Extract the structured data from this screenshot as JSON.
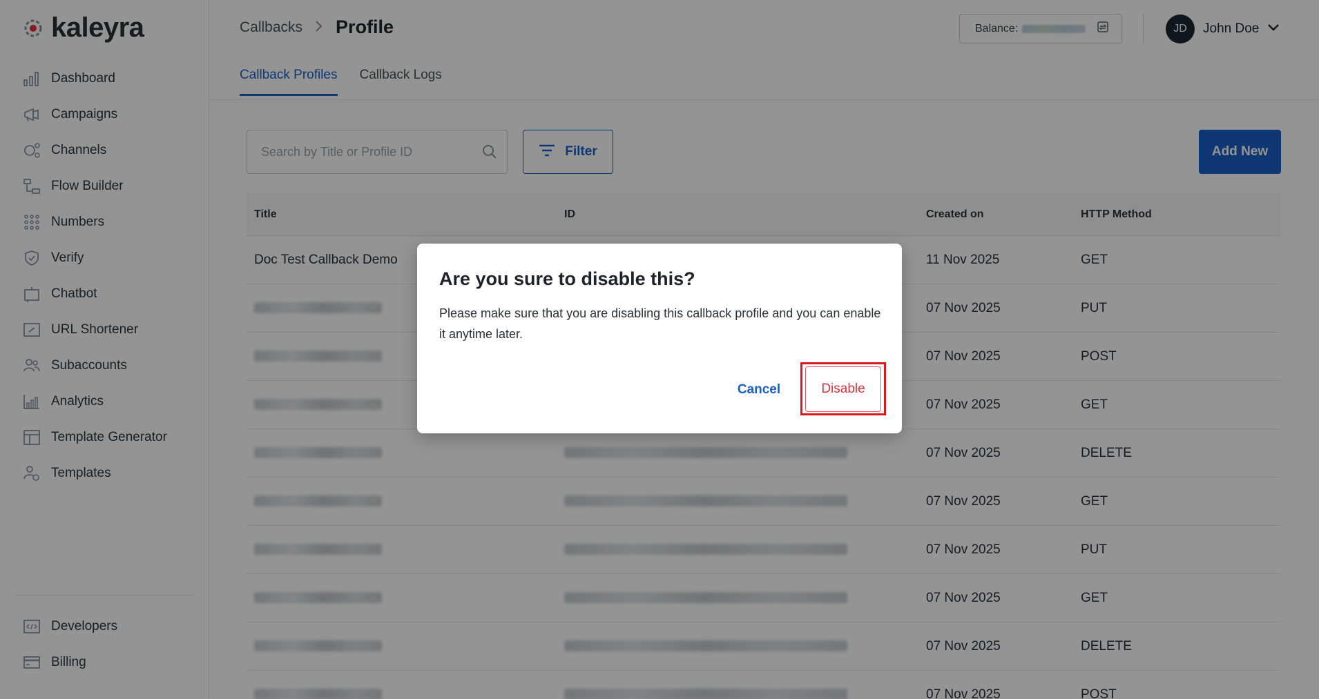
{
  "app": {
    "logo_text": "kaleyra"
  },
  "sidebar": {
    "items": [
      {
        "label": "Dashboard",
        "icon": "bar-chart-icon"
      },
      {
        "label": "Campaigns",
        "icon": "megaphone-icon"
      },
      {
        "label": "Channels",
        "icon": "channels-icon"
      },
      {
        "label": "Flow Builder",
        "icon": "flow-icon"
      },
      {
        "label": "Numbers",
        "icon": "dialpad-icon"
      },
      {
        "label": "Verify",
        "icon": "shield-check-icon"
      },
      {
        "label": "Chatbot",
        "icon": "robot-icon"
      },
      {
        "label": "URL Shortener",
        "icon": "link-icon"
      },
      {
        "label": "Subaccounts",
        "icon": "users-icon"
      },
      {
        "label": "Analytics",
        "icon": "analytics-icon"
      },
      {
        "label": "Template Generator",
        "icon": "layout-icon"
      },
      {
        "label": "Templates",
        "icon": "template-user-icon"
      }
    ],
    "bottom_items": [
      {
        "label": "Developers",
        "icon": "code-icon"
      },
      {
        "label": "Billing",
        "icon": "card-icon"
      }
    ]
  },
  "header": {
    "breadcrumb_parent": "Callbacks",
    "breadcrumb_sep": ">",
    "breadcrumb_current": "Profile",
    "balance_label": "Balance:",
    "user_initials": "JD",
    "user_name": "John Doe"
  },
  "tabs": [
    {
      "label": "Callback Profiles",
      "active": true
    },
    {
      "label": "Callback Logs",
      "active": false
    }
  ],
  "toolbar": {
    "search_placeholder": "Search by Title or Profile ID",
    "filter_label": "Filter",
    "add_label": "Add New"
  },
  "table": {
    "columns": [
      "Title",
      "ID",
      "Created on",
      "HTTP Method"
    ],
    "rows": [
      {
        "title": "Doc Test Callback Demo",
        "created": "11 Nov 2025",
        "method": "GET"
      },
      {
        "title": "",
        "created": "07 Nov 2025",
        "method": "PUT"
      },
      {
        "title": "",
        "created": "07 Nov 2025",
        "method": "POST"
      },
      {
        "title": "",
        "created": "07 Nov 2025",
        "method": "GET"
      },
      {
        "title": "",
        "created": "07 Nov 2025",
        "method": "DELETE"
      },
      {
        "title": "",
        "created": "07 Nov 2025",
        "method": "GET"
      },
      {
        "title": "",
        "created": "07 Nov 2025",
        "method": "PUT"
      },
      {
        "title": "",
        "created": "07 Nov 2025",
        "method": "GET"
      },
      {
        "title": "",
        "created": "07 Nov 2025",
        "method": "DELETE"
      },
      {
        "title": "",
        "created": "07 Nov 2025",
        "method": "POST"
      }
    ]
  },
  "modal": {
    "title": "Are you sure to disable this?",
    "body": "Please make sure that you are disabling this callback profile and you can enable it anytime later.",
    "cancel_label": "Cancel",
    "disable_label": "Disable"
  },
  "colors": {
    "accent": "#1a5fc9",
    "danger": "#e0303c",
    "highlight": "#e0161f"
  }
}
